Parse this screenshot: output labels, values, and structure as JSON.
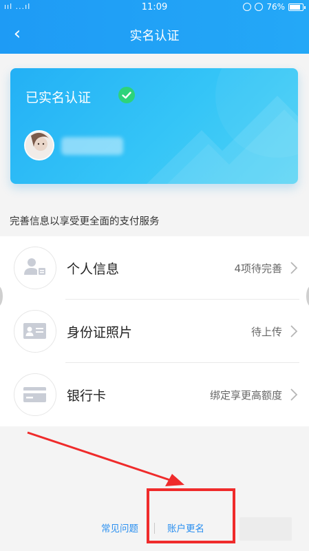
{
  "status_bar": {
    "signal": "ııl ...ıl",
    "time": "11:09",
    "battery": "76%"
  },
  "nav": {
    "back": "‹",
    "title": "实名认证"
  },
  "card": {
    "title": "已实名认证"
  },
  "hint": "完善信息以享受更全面的支付服务",
  "rows": [
    {
      "label": "个人信息",
      "value": "4项待完善",
      "icon": "person-id-icon"
    },
    {
      "label": "身份证照片",
      "value": "待上传",
      "icon": "id-card-icon"
    },
    {
      "label": "银行卡",
      "value": "绑定享更高额度",
      "icon": "bank-card-icon"
    }
  ],
  "footer": {
    "faq": "常见问题",
    "rename": "账户更名"
  },
  "colors": {
    "header_blue": "#1e9bf5",
    "link_blue": "#2a8ff0",
    "verified_green": "#2dd37a",
    "annotation_red": "#ef2b2b"
  }
}
